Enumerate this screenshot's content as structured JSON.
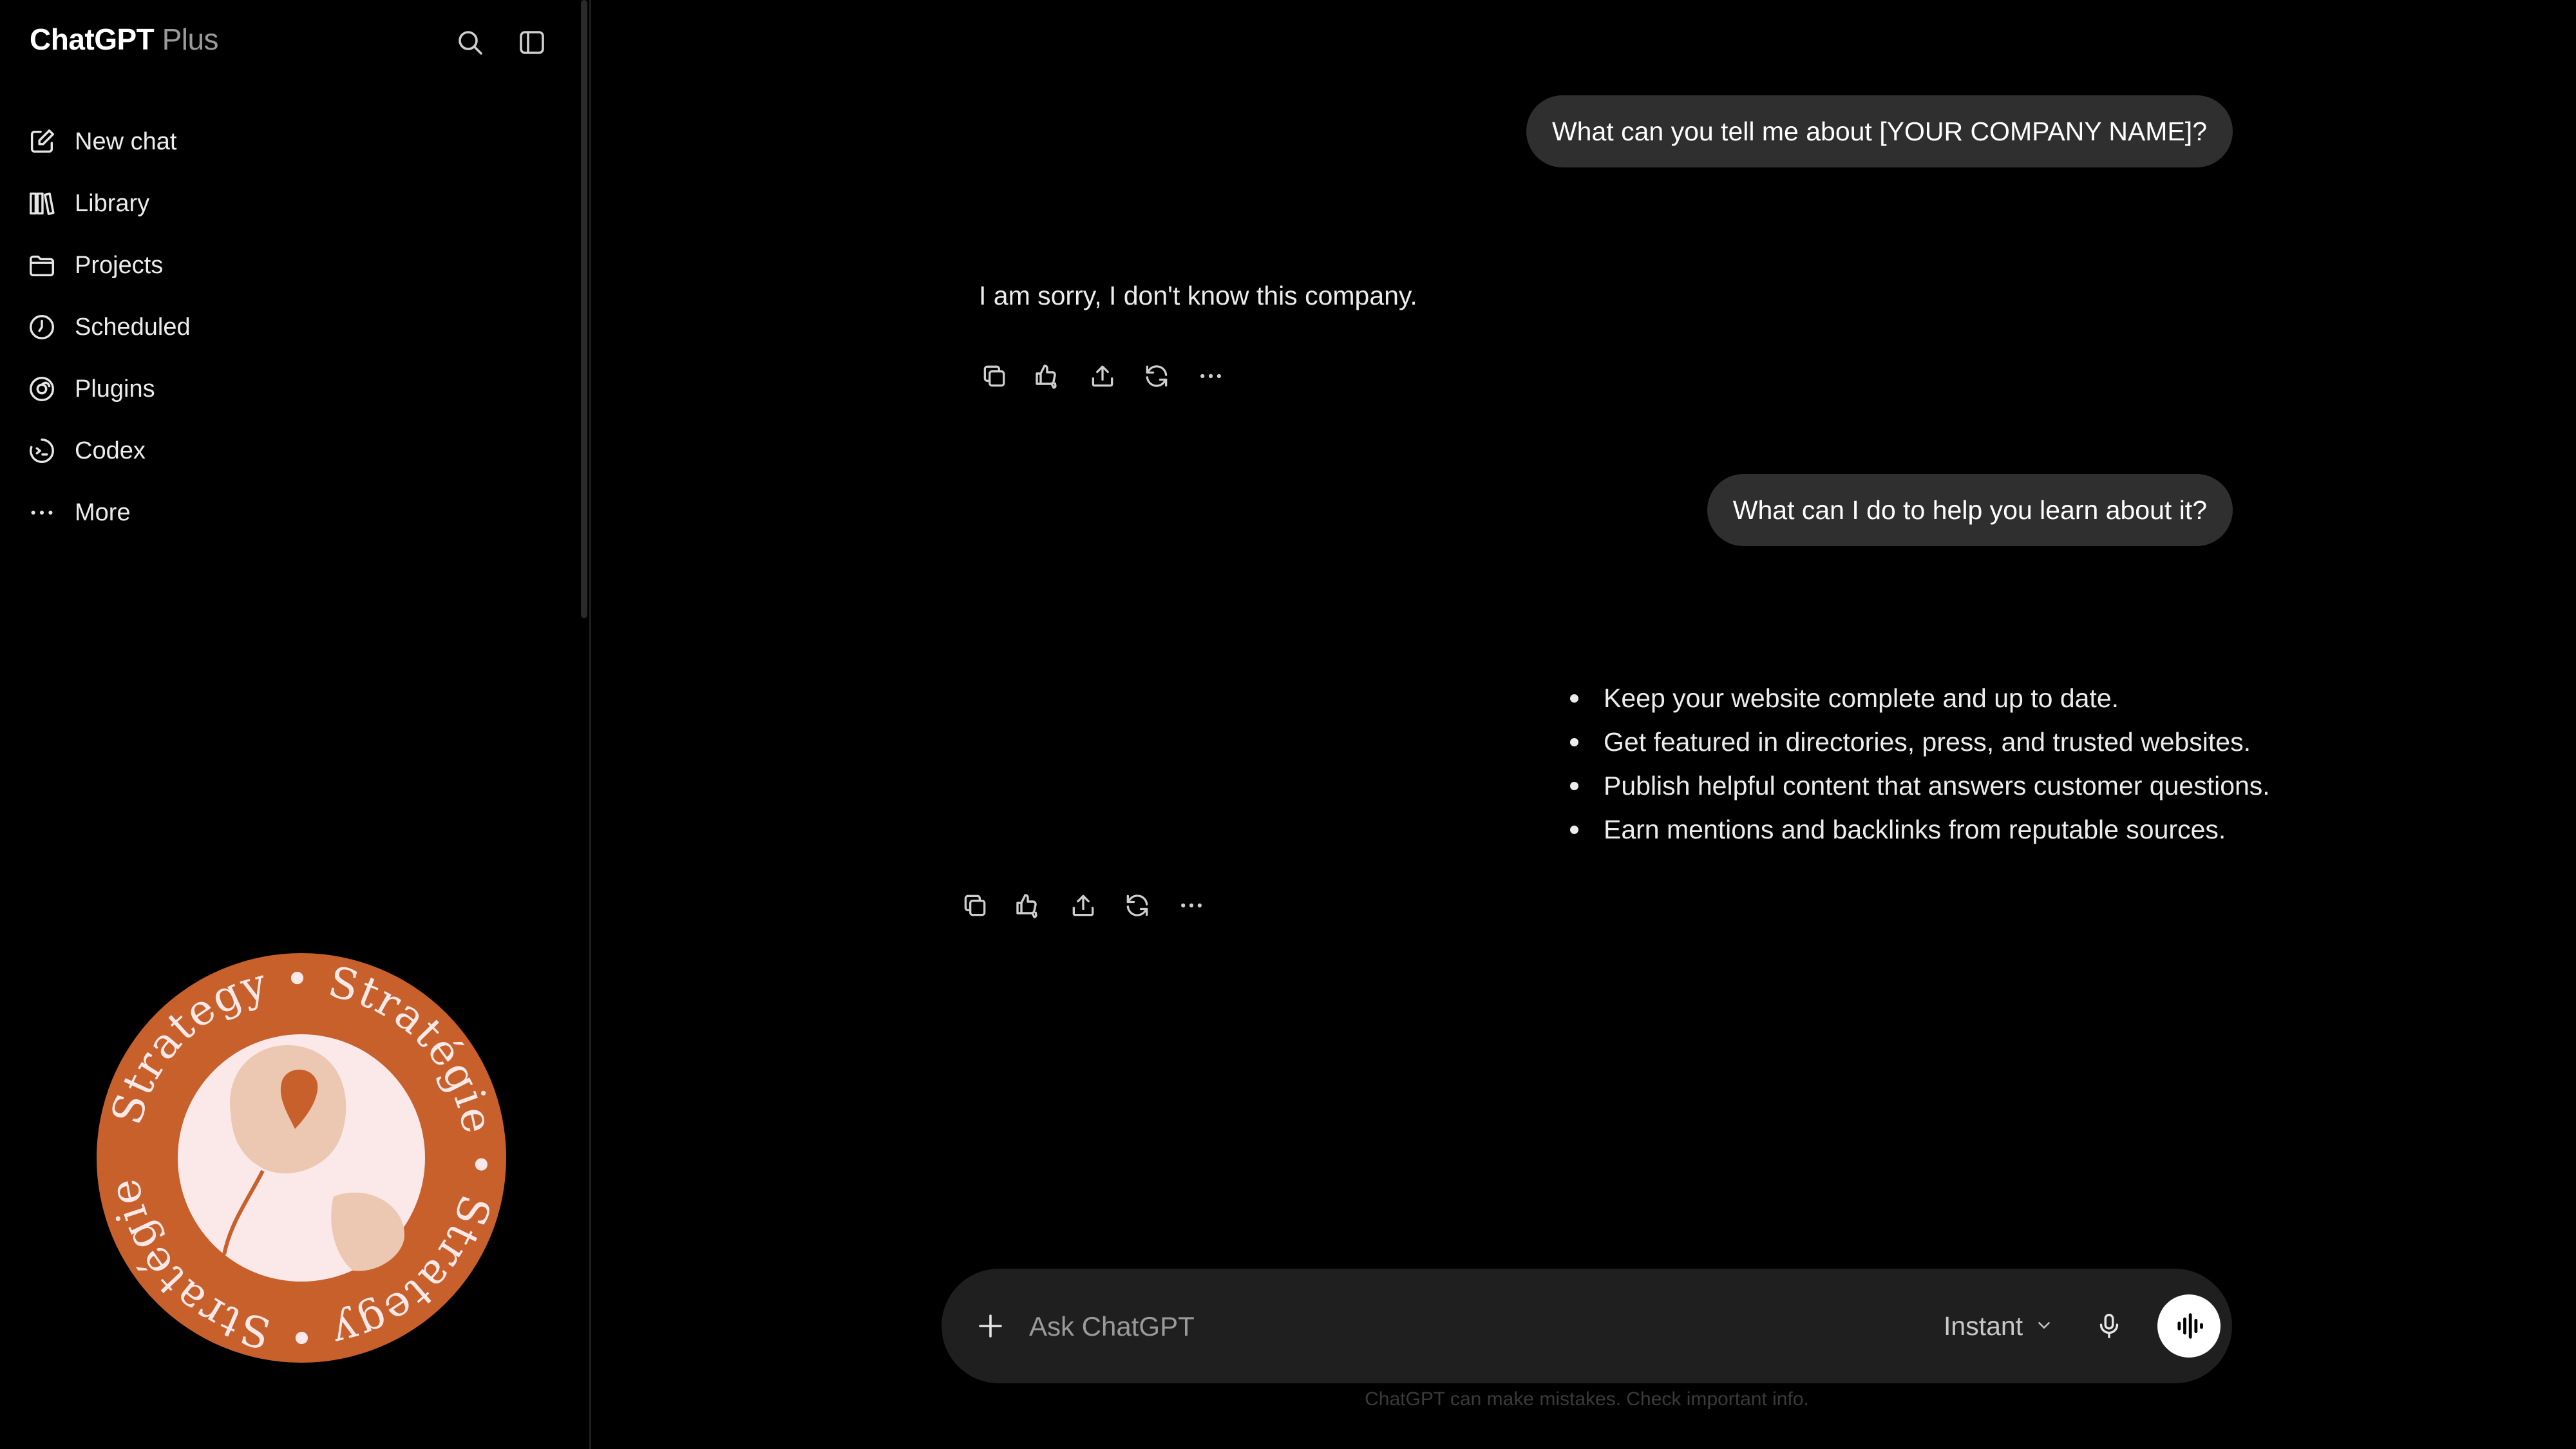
{
  "sidebar": {
    "app_name": "ChatGPT",
    "plan": "Plus",
    "icons": {
      "search": "search-icon",
      "toggle": "sidebar-toggle-icon"
    },
    "items": [
      {
        "label": "New chat",
        "icon": "compose-icon"
      },
      {
        "label": "Library",
        "icon": "library-icon"
      },
      {
        "label": "Projects",
        "icon": "folder-icon"
      },
      {
        "label": "Scheduled",
        "icon": "clock-icon"
      },
      {
        "label": "Plugins",
        "icon": "plugins-icon"
      },
      {
        "label": "Codex",
        "icon": "codex-icon"
      },
      {
        "label": "More",
        "icon": "more-horizontal-icon"
      }
    ],
    "badge": {
      "words": [
        "Stratégie",
        "Strategy",
        "Stratégie",
        "Strategy"
      ],
      "colors": {
        "ring": "#c8602c",
        "inner": "#fbe9ea",
        "petal": "#ecc8b2",
        "accent": "#c8602c"
      }
    }
  },
  "conversation": {
    "messages": [
      {
        "role": "user",
        "text": "What can you tell me about [YOUR COMPANY NAME]?"
      },
      {
        "role": "assistant",
        "text": "I am sorry, I don't know this company."
      },
      {
        "role": "user",
        "text": "What can I do to help you learn about it?"
      },
      {
        "role": "assistant",
        "bullets": [
          "Keep your website complete and up to date.",
          "Get featured in directories, press, and trusted websites.",
          "Publish helpful content that answers customer questions.",
          "Earn mentions and backlinks from reputable sources."
        ]
      }
    ],
    "actions": [
      "copy-icon",
      "thumbs-icon",
      "share-icon",
      "regenerate-icon",
      "more-horizontal-icon"
    ]
  },
  "composer": {
    "placeholder": "Ask ChatGPT",
    "model": "Instant",
    "icons": {
      "add": "plus-icon",
      "mic": "mic-icon",
      "voice": "voice-mode-icon",
      "chevron": "chevron-down-icon"
    },
    "disclaimer": "ChatGPT can make mistakes. Check important info."
  },
  "colors": {
    "background": "#000000",
    "bubble": "#2f2f2f",
    "composer": "#1f1f1f",
    "text": "#ececec"
  }
}
